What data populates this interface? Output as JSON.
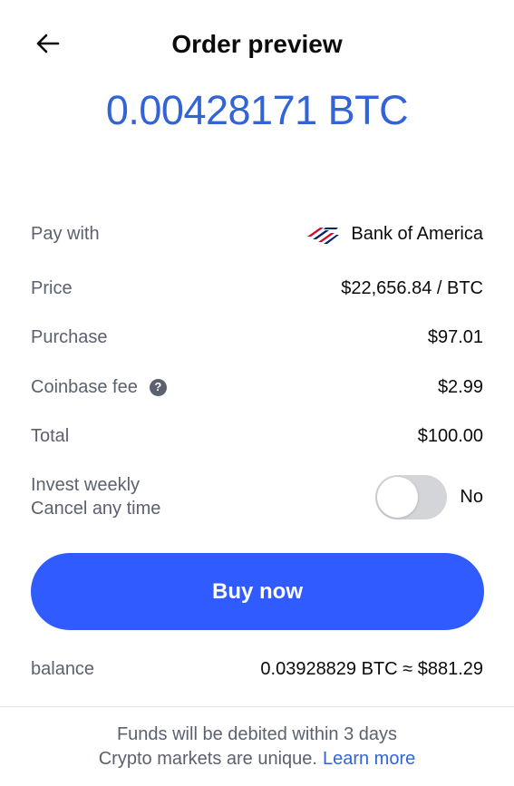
{
  "header": {
    "title": "Order preview",
    "back_icon": "arrow-left-icon"
  },
  "order": {
    "amount": "0.00428171 BTC"
  },
  "details": {
    "pay_with": {
      "label": "Pay with",
      "value": "Bank of America",
      "icon": "bank-of-america-logo"
    },
    "price": {
      "label": "Price",
      "value": "$22,656.84 / BTC"
    },
    "purchase": {
      "label": "Purchase",
      "value": "$97.01"
    },
    "fee": {
      "label": "Coinbase fee",
      "value": "$2.99",
      "help_icon": "?"
    },
    "total": {
      "label": "Total",
      "value": "$100.00"
    }
  },
  "invest": {
    "line1": "Invest weekly",
    "line2": "Cancel any time",
    "toggle_state": "No",
    "enabled": false
  },
  "actions": {
    "buy_label": "Buy now"
  },
  "balance": {
    "label": "balance",
    "value": "0.03928829 BTC ≈ $881.29"
  },
  "footer": {
    "line1": "Funds will be debited within 3 days",
    "line2": "Crypto markets are unique.",
    "link": "Learn more"
  },
  "colors": {
    "accent": "#2f5bff",
    "amount": "#3264d8",
    "muted_text": "#5b616e",
    "toggle_off": "#d4d5d9"
  }
}
